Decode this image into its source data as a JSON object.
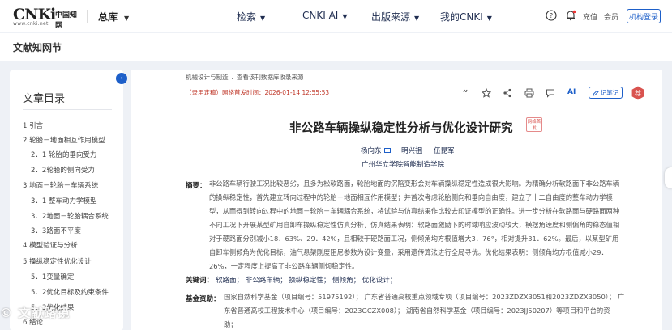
{
  "brand": {
    "logo_main": "CNKi",
    "logo_cn": "中国知网",
    "logo_url": "www.cnki.net"
  },
  "topnav": {
    "library_label": "总库",
    "items": [
      "检索",
      "CNKI AI",
      "出版来源",
      "我的CNKI"
    ],
    "charge_label": "充值",
    "member_label": "会员",
    "login_label": "机构登录"
  },
  "subheader": {
    "title": "文献知网节"
  },
  "toc": {
    "title": "文章目录",
    "items": [
      "1 引言",
      "2 轮胎－地面相互作用模型",
      "2．1 轮胎的垂向受力",
      "2．2轮胎的侧向受力",
      "3 地面－轮胎－车辆系统",
      "3．1 整车动力学模型",
      "3．2地面－轮胎耦合系统",
      "3．3路面不平度",
      "4 模型验证与分析",
      "5 操纵稳定性优化设计",
      "5．1变量确定",
      "5．2优化目标及约束条件",
      "5．3优化结果",
      "6 结论"
    ]
  },
  "article": {
    "breadcrumb_1": "机械设计与制造",
    "breadcrumb_sep": ".",
    "breadcrumb_2": "查看该刊数据库收录来源",
    "publish_time": "（录用定稿）网络首发时间：2026-01-14 12:55:53",
    "note_button": "记笔记",
    "ai_label": "AI",
    "title": "非公路车辆操纵稳定性分析与优化设计研究",
    "first_badge": "网络首发",
    "authors": [
      "杨向东",
      "明兴祖",
      "伍昆军"
    ],
    "affiliation": "广州华立学院智能制造学院",
    "abstract_label": "摘要：",
    "abstract_lines": [
      "非公路车辆行驶工况比较恶劣，且多为松软路面，轮胎地面的沉陷变形会对车辆操纵稳定性造成很大影响。为精确分析软路面下非公路车辆",
      "的操纵稳定性，首先建立转向过程中的轮胎－地面相互作用模型；并首次考虑轮胎侧向和垂向自由度，建立了十二自由度的整车动力学模",
      "型，从而得到转向过程中的地面－轮胎－车辆耦合系统，将试验与仿真结果作比较去印证模型的正确性。进一步分析在软路面与硬路面两种",
      "不同工况下开展某型矿用自卸车操纵稳定性仿真分析，仿真结果表明：软路面激励下的时域响应波动较大，横摆角速度和侧偏角的稳态值相",
      "对于硬路面分别减小18．63%、29．42%，且相较于硬路面工况，侧倾角均方根值增大3．76°，相对提升31．62%。最后，以某型矿用",
      "自卸车侧倾角为优化目标，油气悬架刚度阻尼参数为设计变量，采用遗传算法进行全局寻优。优化结果表明：侧倾角均方根值减小29．",
      "26%，一定程度上提高了非公路车辆侧倾稳定性。"
    ],
    "keywords_label": "关键词：",
    "keywords": "软路面；  非公路车辆；  操纵稳定性；  侧倾角；  优化设计；",
    "fund_label": "基金资助：",
    "fund_lines": [
      "国家自然科学基金（项目编号：51975192）；  广东省普通高校重点领域专项（项目编号：2023ZDZX3051和2023ZDZX3050）；  广",
      "东省普通高校工程技术中心（项目编号：2023GCZX008）；  湖南省自然科学基金（项目编号：2023JJ50207）等项目和平台的资",
      "助；"
    ]
  },
  "watermark": "© 文献路镜",
  "colors": {
    "accent": "#1d5fc9",
    "time_red": "#c0392b",
    "bg": "#eef1f6"
  }
}
